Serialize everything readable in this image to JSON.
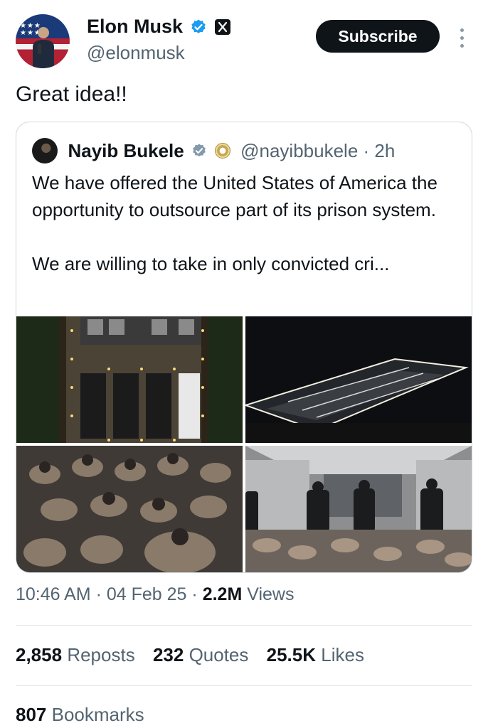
{
  "author": {
    "display_name": "Elon Musk",
    "handle": "@elonmusk",
    "subscribe_label": "Subscribe",
    "verified_color": "#1d9bf0"
  },
  "tweet": {
    "text": "Great idea!!"
  },
  "quoted": {
    "display_name": "Nayib Bukele",
    "handle": "@nayibbukele",
    "separator": "·",
    "time": "2h",
    "paragraph_1": "We have offered the United States of America the opportunity to outsource part of its prison system.",
    "paragraph_2": "We are willing to take in only convicted cri...",
    "verified_color": "#829aab"
  },
  "meta": {
    "time": "10:46 AM",
    "sep1": "·",
    "date": "04 Feb 25",
    "sep2": "·",
    "views_count": "2.2M",
    "views_label": "Views"
  },
  "stats": {
    "reposts_count": "2,858",
    "reposts_label": "Reposts",
    "quotes_count": "232",
    "quotes_label": "Quotes",
    "likes_count": "25.5K",
    "likes_label": "Likes",
    "bookmarks_count": "807",
    "bookmarks_label": "Bookmarks"
  }
}
